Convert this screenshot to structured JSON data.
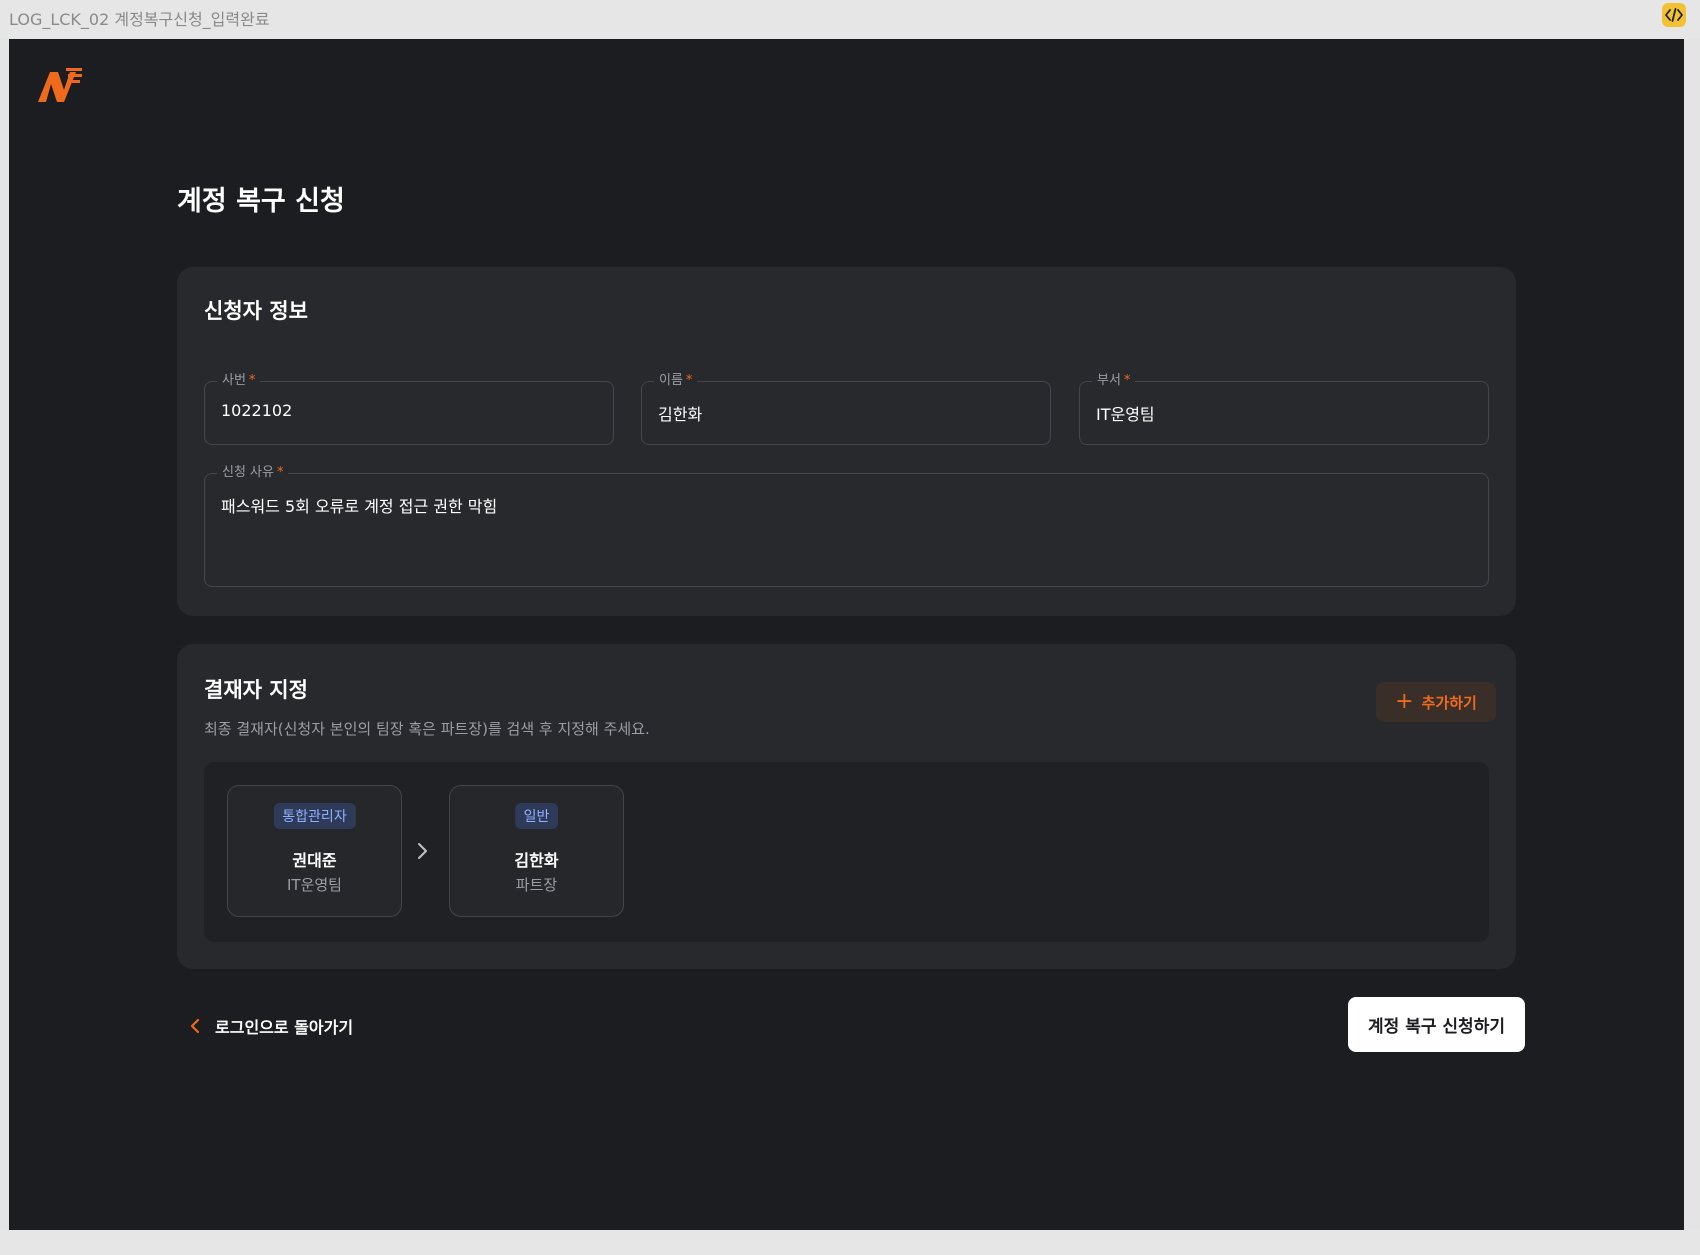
{
  "window": {
    "frame_title": "LOG_LCK_02 계정복구신청_입력완료",
    "code_icon": "code-icon"
  },
  "brand": {
    "accent": "#f06a1e",
    "background": "#1c1d20",
    "card": "#27292d"
  },
  "page": {
    "title": "계정 복구 신청"
  },
  "applicant": {
    "section_title": "신청자 정보",
    "employee_id": {
      "label": "사번",
      "required_mark": "*",
      "value": "1022102"
    },
    "name": {
      "label": "이름",
      "required_mark": "*",
      "value": "김한화"
    },
    "department": {
      "label": "부서",
      "required_mark": "*",
      "value": "IT운영팀"
    },
    "reason": {
      "label": "신청 사유",
      "required_mark": "*",
      "value": "패스워드 5회 오류로 계정 접근 권한 막힘"
    }
  },
  "approver": {
    "section_title": "결재자 지정",
    "description": "최종 결재자(신청자 본인의 팀장 혹은 파트장)를 검색 후 지정해 주세요.",
    "add_label": "추가하기",
    "add_icon": "plus-icon",
    "chain": [
      {
        "role": "통합관리자",
        "name": "권대준",
        "dept": "IT운영팀"
      },
      {
        "role": "일반",
        "name": "김한화",
        "dept": "파트장"
      }
    ]
  },
  "footer": {
    "back_label": "로그인으로 돌아가기",
    "back_icon": "chevron-left-icon",
    "submit_label": "계정 복구 신청하기"
  }
}
